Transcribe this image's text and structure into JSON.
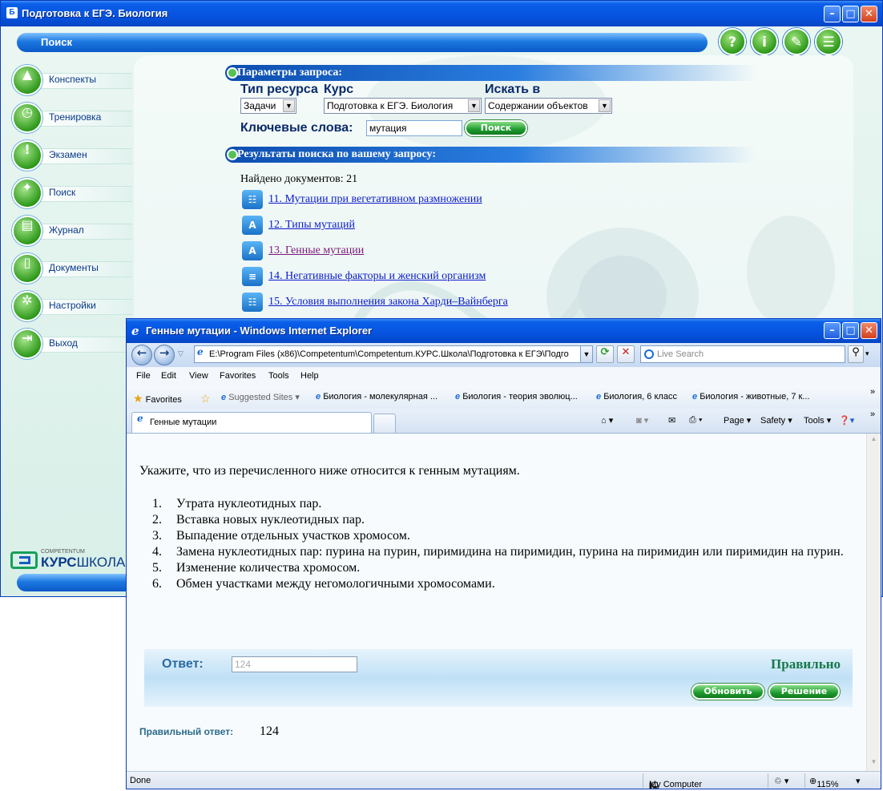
{
  "app": {
    "title": "Подготовка к ЕГЭ. Биология",
    "section_label": "Поиск",
    "top_icons": [
      "help-icon",
      "info-icon",
      "edit-icon",
      "chat-icon"
    ],
    "sidebar": [
      {
        "label": "Конспекты",
        "icon": "graduation-cap-icon"
      },
      {
        "label": "Тренировка",
        "icon": "stopwatch-icon"
      },
      {
        "label": "Экзамен",
        "icon": "exclamation-icon"
      },
      {
        "label": "Поиск",
        "icon": "search-icon"
      },
      {
        "label": "Журнал",
        "icon": "journal-icon"
      },
      {
        "label": "Документы",
        "icon": "document-icon"
      },
      {
        "label": "Настройки",
        "icon": "gear-icon"
      },
      {
        "label": "Выход",
        "icon": "exit-icon"
      }
    ],
    "logo": {
      "small": "COMPETENTUM",
      "part1": "КУРС",
      "part2": "ШКОЛА"
    },
    "params": {
      "header": "Параметры запроса:",
      "resource_type_label": "Тип ресурса",
      "course_label": "Курс",
      "search_in_label": "Искать в",
      "resource_type_value": "Задачи",
      "course_value": "Подготовка к ЕГЭ. Биология",
      "search_in_value": "Содержании объектов",
      "keywords_label": "Ключевые слова:",
      "keywords_value": "мутация",
      "search_button": "Поиск"
    },
    "results": {
      "header": "Результаты поиска по вашему запросу:",
      "found": "Найдено документов: 21",
      "items": [
        {
          "text": "11. Мутации при вегетативном размножении",
          "icon": "task-list-icon"
        },
        {
          "text": "12. Типы мутаций",
          "icon": "text-doc-icon"
        },
        {
          "text": "13. Генные мутации",
          "icon": "text-doc-icon"
        },
        {
          "text": "14. Негативные факторы и женский организм",
          "icon": "article-icon"
        },
        {
          "text": "15. Условия выполнения закона Харди–Вайнберга",
          "icon": "task-list-icon"
        }
      ]
    }
  },
  "ie": {
    "title": "Генные мутации - Windows Internet Explorer",
    "address": "E:\\Program Files (x86)\\Competentum\\Competentum.КУРС.Школа\\Подготовка к ЕГЭ\\Подго",
    "search_placeholder": "Live Search",
    "menu": [
      "File",
      "Edit",
      "View",
      "Favorites",
      "Tools",
      "Help"
    ],
    "favorites_label": "Favorites",
    "suggested_sites": "Suggested Sites ▾",
    "fav_links": [
      "Биология - молекулярная ...",
      "Биология - теория эволюц...",
      "Биология, 6 класс",
      "Биология - животные, 7 к..."
    ],
    "tab_title": "Генные мутации",
    "commands": {
      "page": "Page ▾",
      "safety": "Safety ▾",
      "tools": "Tools ▾"
    },
    "status": {
      "left": "Done",
      "zone": "My Computer",
      "zoom": "115%"
    }
  },
  "task": {
    "question": "Укажите, что из перечисленного ниже относится к генным мутациям.",
    "options": [
      {
        "n": "1.",
        "text": "Утрата нуклеотидных пар."
      },
      {
        "n": "2.",
        "text": "Вставка новых нуклеотидных пар."
      },
      {
        "n": "3.",
        "text": "Выпадение отдельных участков хромосом."
      },
      {
        "n": "4.",
        "text": "Замена нуклеотидных пар: пурина на пурин, пиримидина на пиримидин, пурина на пиримидин или пиримидин на пурин."
      },
      {
        "n": "5.",
        "text": "Изменение количества хромосом."
      },
      {
        "n": "6.",
        "text": "Обмен участками между негомологичными хромосомами."
      }
    ],
    "answer_label": "Ответ:",
    "answer_value": "124",
    "verdict": "Правильно",
    "update_button": "Обновить",
    "solution_button": "Решение",
    "correct_label": "Правильный ответ:",
    "correct_value": "124"
  },
  "colors": {
    "accent_blue": "#0a5fe8",
    "link": "#0b1bcc",
    "visited_link": "#7a1a7a",
    "verdict_green": "#16784a"
  }
}
